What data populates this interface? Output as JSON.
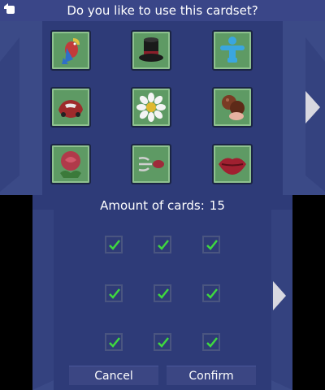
{
  "top_screen": {
    "prompt": "Do you like to use this cardset?",
    "back_icon": "back-hand-icon",
    "cards": [
      {
        "icon": "parrot-icon",
        "colors": [
          "#c23a3a",
          "#2f6fc9",
          "#e0c040"
        ]
      },
      {
        "icon": "top-hat-icon",
        "colors": [
          "#1a1a1a",
          "#8a1f2a"
        ]
      },
      {
        "icon": "person-figure-icon",
        "colors": [
          "#3aa6e0"
        ]
      },
      {
        "icon": "car-icon",
        "colors": [
          "#9e2b2b",
          "#e8e8e8"
        ]
      },
      {
        "icon": "daisy-icon",
        "colors": [
          "#f4f4f4",
          "#e0b830"
        ]
      },
      {
        "icon": "chocolates-icon",
        "colors": [
          "#7a3b24",
          "#e7b2a0"
        ]
      },
      {
        "icon": "rose-icon",
        "colors": [
          "#b03a4a",
          "#3b7a3a"
        ]
      },
      {
        "icon": "kiss-wind-icon",
        "colors": [
          "#9e2b3a",
          "#d0d0d0"
        ]
      },
      {
        "icon": "lips-icon",
        "colors": [
          "#a02030"
        ]
      }
    ],
    "next_arrow": "chevron-right-icon"
  },
  "bottom_screen": {
    "amount_label": "Amount of cards:",
    "amount_value": "15",
    "checkboxes_checked": [
      true,
      true,
      true,
      true,
      true,
      true,
      true,
      true,
      true
    ],
    "next_arrow": "chevron-right-icon",
    "cancel_label": "Cancel",
    "confirm_label": "Confirm"
  },
  "colors": {
    "background": "#2e3b78",
    "card_green": "#5e9a64",
    "check_green": "#3fd83f"
  }
}
